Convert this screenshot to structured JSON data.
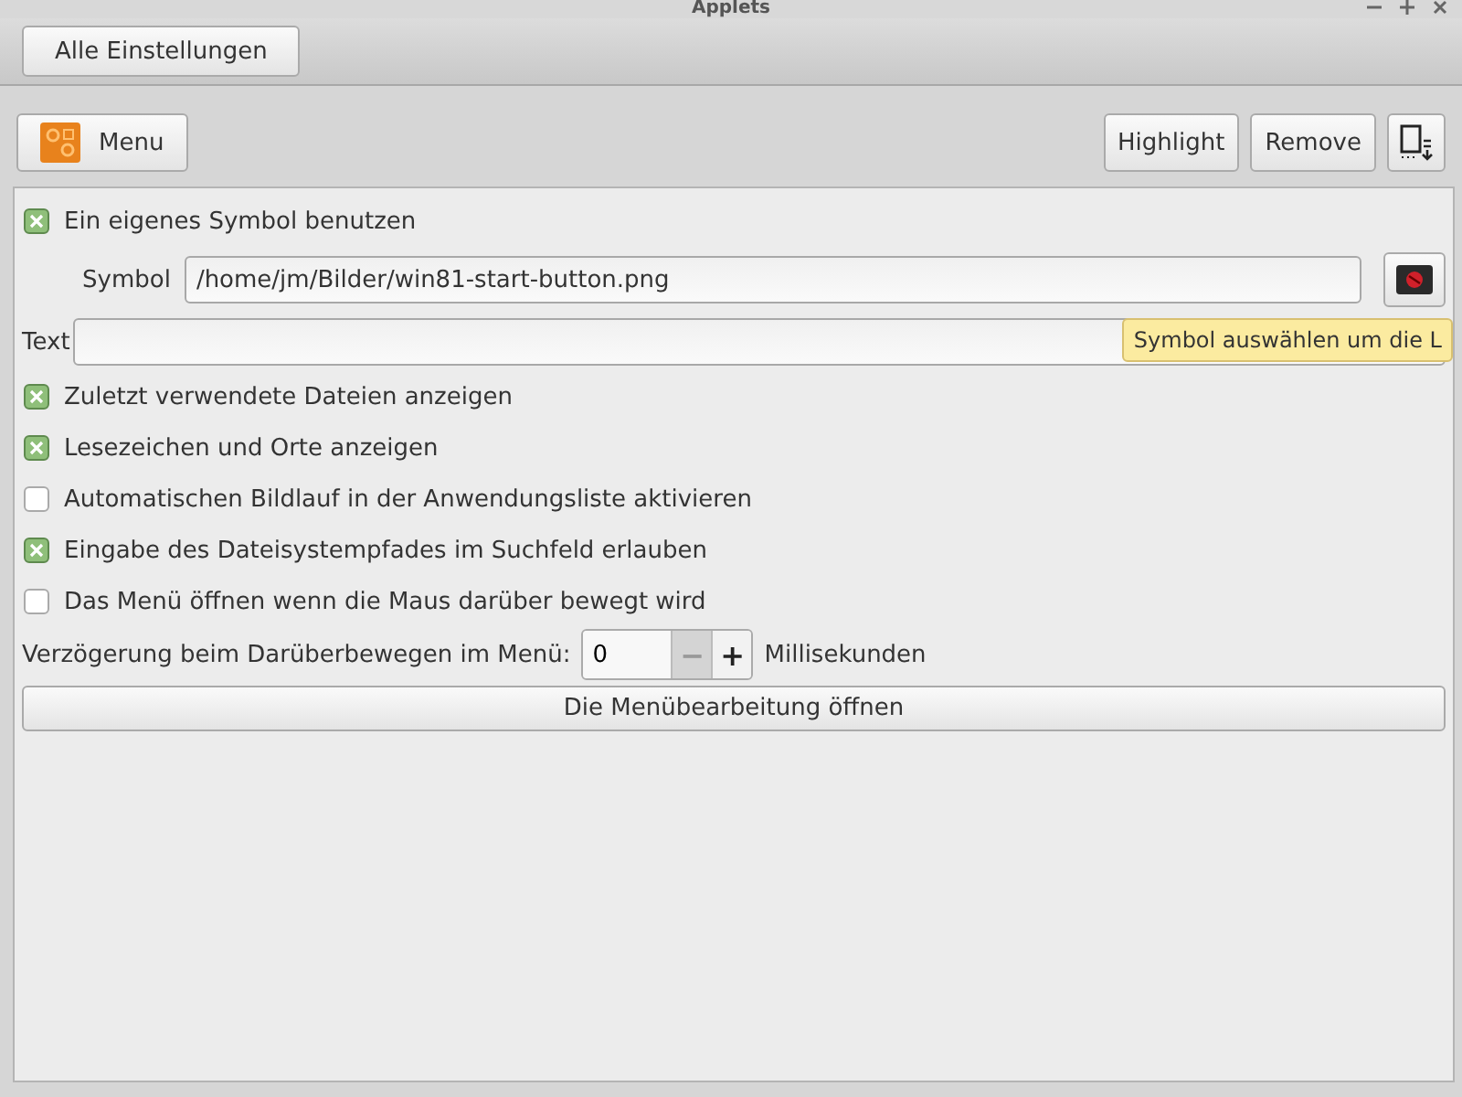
{
  "window": {
    "title": "Applets"
  },
  "header": {
    "back_button": "Alle Einstellungen"
  },
  "toolbar": {
    "applet_button": "Menu",
    "buttons": [
      "Highlight",
      "Remove"
    ]
  },
  "settings": [
    {
      "kind": "checkbox",
      "label": "Ein eigenes Symbol benutzen",
      "checked": true
    },
    {
      "kind": "file",
      "label": "Symbol",
      "value": "/home/jm/Bilder/win81-start-button.png"
    },
    {
      "kind": "text",
      "label": "Text"
    },
    {
      "kind": "checkbox",
      "label": "Zuletzt verwendete Dateien anzeigen",
      "checked": true
    },
    {
      "kind": "checkbox",
      "label": "Lesezeichen und Orte anzeigen",
      "checked": true
    },
    {
      "kind": "checkbox",
      "label": "Automatischen Bildlauf in der Anwendungsliste aktivieren",
      "checked": false
    },
    {
      "kind": "checkbox",
      "label": "Eingabe des Dateisystempfades im Suchfeld erlauben",
      "checked": true
    },
    {
      "kind": "checkbox",
      "label": "Das Menü öffnen wenn die Maus darüber bewegt wird",
      "checked": false
    },
    {
      "kind": "spin",
      "label": "Verzögerung beim Darüberbewegen im Menü:",
      "value": "0",
      "minus": "−",
      "plus": "+",
      "unit": "Millisekunden"
    },
    {
      "kind": "button",
      "label": "Die Menübearbeitung öffnen"
    }
  ],
  "tooltip": "Symbol auswählen um die L"
}
